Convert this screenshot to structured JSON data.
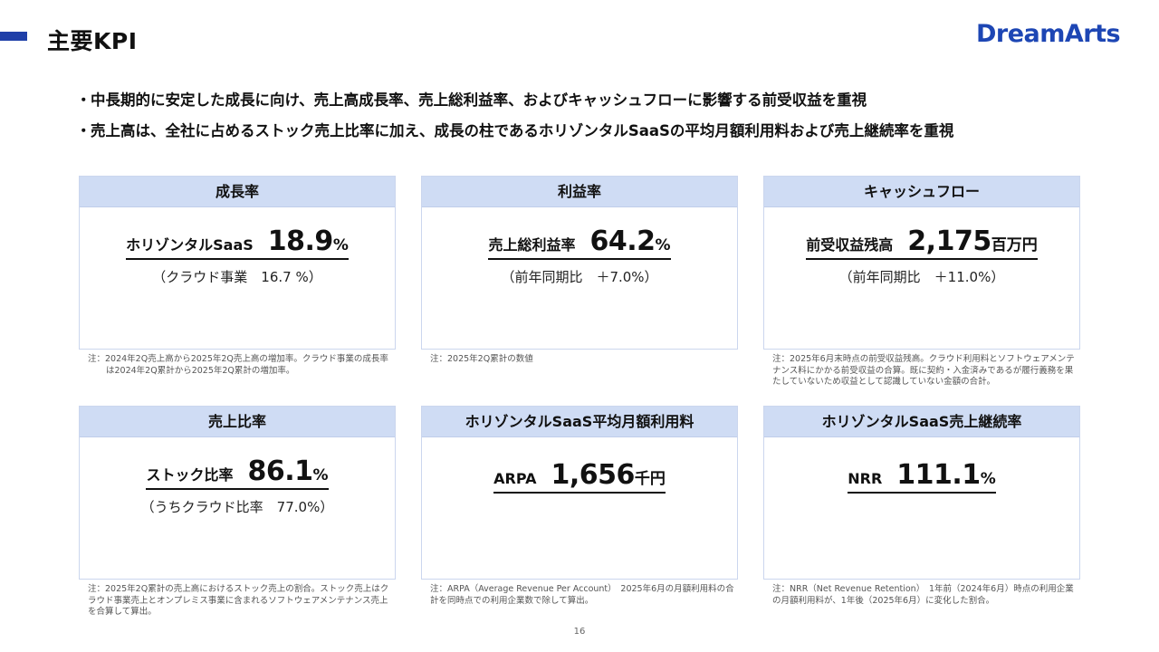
{
  "header": {
    "title": "主要KPI",
    "logo": "DreamArts",
    "accent_color": "#1f3fa8",
    "logo_color": "#1d46b4"
  },
  "bullets": [
    "中長期的に安定した成長に向け、売上高成長率、売上総利益率、およびキャッシュフローに影響する前受収益を重視",
    "売上高は、全社に占めるストック売上比率に加え、成長の柱であるホリゾンタルSaaSの平均月額利用料および売上継続率を重視"
  ],
  "bullet_marker": "・",
  "cards": [
    {
      "header": "成長率",
      "label": "ホリゾンタルSaaS",
      "value": "18.9",
      "unit": "%",
      "sub": "（クラウド事業　16.7 %）",
      "note": "注：2024年2Q売上高から2025年2Q売上高の増加率。クラウド事業の成長率は2024年2Q累計から2025年2Q累計の増加率。"
    },
    {
      "header": "利益率",
      "label": "売上総利益率",
      "value": "64.2",
      "unit": "%",
      "sub": "（前年同期比　＋7.0%）",
      "note": "注：2025年2Q累計の数値"
    },
    {
      "header": "キャッシュフロー",
      "label": "前受収益残高",
      "value": "2,175",
      "unit": "百万円",
      "sub": "（前年同期比　＋11.0%）",
      "note": "注：2025年6月末時点の前受収益残高。クラウド利用料とソフトウェアメンテナンス料にかかる前受収益の合算。既に契約・入金済みであるが履行義務を果たしていないため収益として認識していない金額の合計。"
    },
    {
      "header": "売上比率",
      "label": "ストック比率",
      "value": "86.1",
      "unit": "%",
      "sub": "（うちクラウド比率　77.0%）",
      "note": "注：2025年2Q累計の売上高におけるストック売上の割合。ストック売上はクラウド事業売上とオンプレミス事業に含まれるソフトウェアメンテナンス売上を合算して算出。"
    },
    {
      "header": "ホリゾンタルSaaS平均月額利用料",
      "label": "ARPA",
      "value": "1,656",
      "unit": "千円",
      "sub": "",
      "note": "注：ARPA（Average Revenue Per Account）　2025年6月の月額利用料の合計を同時点での利用企業数で除して算出。"
    },
    {
      "header": "ホリゾンタルSaaS売上継続率",
      "label": "NRR",
      "value": "111.1",
      "unit": "%",
      "sub": "",
      "note": "注：NRR（Net Revenue Retention）　1年前（2024年6月）時点の利用企業の月額利用料が、1年後（2025年6月）に変化した割合。"
    }
  ],
  "page_number": "16",
  "colors": {
    "card_header_bg": "#cfdcf4",
    "card_border": "#cbd6ee"
  }
}
